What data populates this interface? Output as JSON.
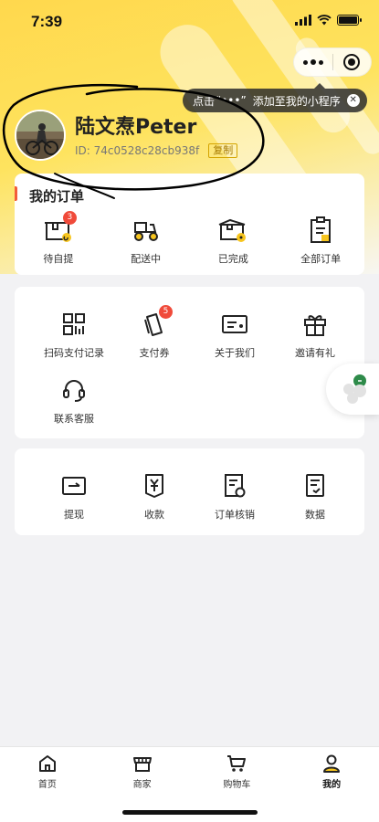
{
  "status_bar": {
    "time": "7:39"
  },
  "tip": {
    "prefix": "点击",
    "dots": "“•••”",
    "suffix": "添加至我的小程序",
    "close": "✕"
  },
  "profile": {
    "name": "陆文焘Peter",
    "id": "ID: 74c0528c28cb938f",
    "copy_label": "复制"
  },
  "orders": {
    "title": "我的订单",
    "items": [
      {
        "label": "待自提",
        "icon": "pickup-box-icon",
        "badge": "3"
      },
      {
        "label": "配送中",
        "icon": "delivery-scooter-icon",
        "badge": null
      },
      {
        "label": "已完成",
        "icon": "completed-box-icon",
        "badge": null
      },
      {
        "label": "全部订单",
        "icon": "clipboard-icon",
        "badge": null
      }
    ]
  },
  "services": {
    "items": [
      {
        "label": "扫码支付记录",
        "icon": "qr-record-icon",
        "badge": null
      },
      {
        "label": "支付券",
        "icon": "coupon-icon",
        "badge": "5"
      },
      {
        "label": "关于我们",
        "icon": "id-card-icon",
        "badge": null
      },
      {
        "label": "邀请有礼",
        "icon": "gift-icon",
        "badge": null
      },
      {
        "label": "联系客服",
        "icon": "headset-icon",
        "badge": null
      }
    ]
  },
  "tools": {
    "items": [
      {
        "label": "提现",
        "icon": "withdraw-icon"
      },
      {
        "label": "收款",
        "icon": "receive-yen-icon"
      },
      {
        "label": "订单核销",
        "icon": "order-verify-icon"
      },
      {
        "label": "数据",
        "icon": "data-doc-icon"
      }
    ]
  },
  "tabbar": {
    "tabs": [
      {
        "label": "首页",
        "icon": "home-icon",
        "active": false
      },
      {
        "label": "商家",
        "icon": "store-icon",
        "active": false
      },
      {
        "label": "购物车",
        "icon": "cart-icon",
        "active": false
      },
      {
        "label": "我的",
        "icon": "profile-icon",
        "active": true
      }
    ]
  },
  "colors": {
    "accent_yellow": "#f7c51e",
    "badge_red": "#f04a3a",
    "order_bar": "#f25c3a"
  }
}
